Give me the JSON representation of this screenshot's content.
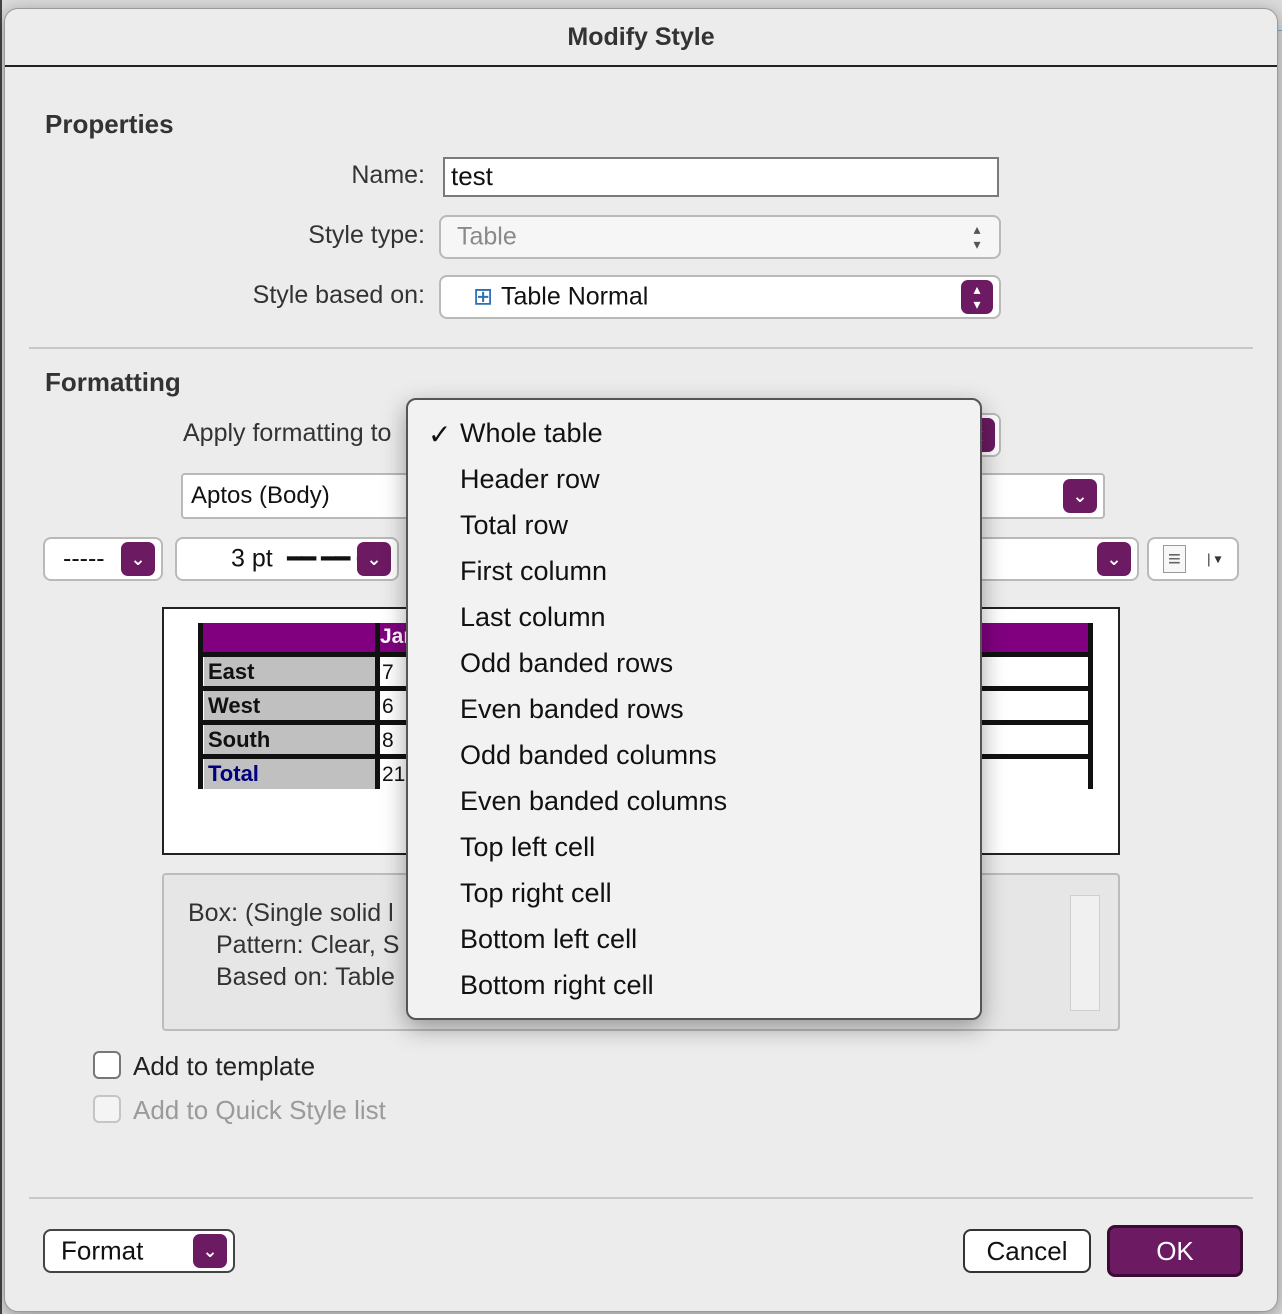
{
  "dialog": {
    "title": "Modify Style"
  },
  "properties": {
    "section_title": "Properties",
    "name_label": "Name:",
    "name_value": "test",
    "style_type_label": "Style type:",
    "style_type_value": "Table",
    "based_on_label": "Style based on:",
    "based_on_value": "Table Normal"
  },
  "formatting": {
    "section_title": "Formatting",
    "apply_to_label": "Apply formatting to:",
    "apply_to_visible": "Apply formatting to",
    "font_value": "Aptos (Body)",
    "border_style_value": "-----",
    "border_width_value": "3 pt"
  },
  "preview": {
    "header_col": "Jan",
    "rows": [
      {
        "label": "East",
        "value": "7"
      },
      {
        "label": "West",
        "value": "6"
      },
      {
        "label": "South",
        "value": "8"
      },
      {
        "label": "Total",
        "value": "21"
      }
    ],
    "colors": {
      "header": "#800080",
      "row_label_bg": "#C0C0C0",
      "total_text": "#000080"
    }
  },
  "description": {
    "line1": "Box: (Single solid l",
    "line2": "Pattern: Clear, S",
    "line3": "Based on: Table"
  },
  "options": {
    "add_to_template": "Add to template",
    "add_to_quick_style": "Add to Quick Style list"
  },
  "footer": {
    "format_label": "Format",
    "cancel_label": "Cancel",
    "ok_label": "OK"
  },
  "menu": {
    "check_mark": "✓",
    "items": [
      "Whole table",
      "Header row",
      "Total row",
      "First column",
      "Last column",
      "Odd banded rows",
      "Even banded rows",
      "Odd banded columns",
      "Even banded columns",
      "Top left cell",
      "Top right cell",
      "Bottom left cell",
      "Bottom right cell"
    ],
    "selected": "Whole table"
  },
  "icons": {
    "table_icon": "⊞",
    "align_icon": "≡",
    "stepper_icon": "⌃⌄",
    "chevron_icon": "⌄"
  },
  "accent_color": "#6C1A62"
}
